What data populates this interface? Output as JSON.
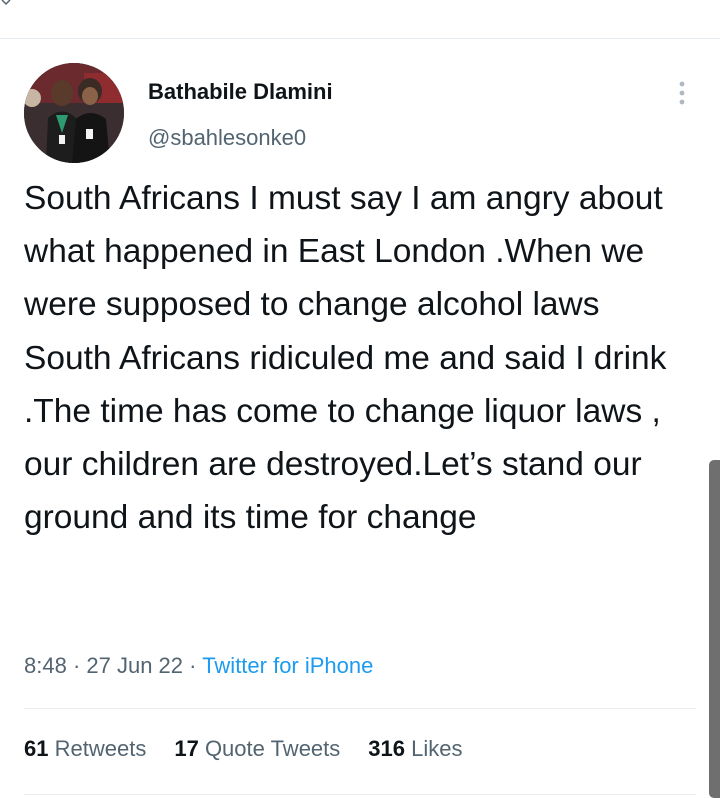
{
  "tweet": {
    "author": {
      "name": "Bathabile Dlamini",
      "handle": "@sbahlesonke0"
    },
    "text": "South Africans I must say I am angry about what happened in East London .When we were supposed to change alcohol laws South Africans ridiculed me and said I drink .The time has come to change liquor laws , our children are destroyed.Let’s stand our ground and its time for change",
    "time": "8:48",
    "separator": " · ",
    "date": "27 Jun 22",
    "source": "Twitter for iPhone",
    "stats": {
      "retweets": {
        "count": "61",
        "label": "Retweets"
      },
      "quote_tweets": {
        "count": "17",
        "label": "Quote Tweets"
      },
      "likes": {
        "count": "316",
        "label": "Likes"
      }
    }
  },
  "colors": {
    "text": "#0f1419",
    "secondary": "#536471",
    "accent": "#1d9bf0",
    "divider": "#e6ecf0"
  },
  "icons": {
    "more": "more-vertical-icon"
  }
}
